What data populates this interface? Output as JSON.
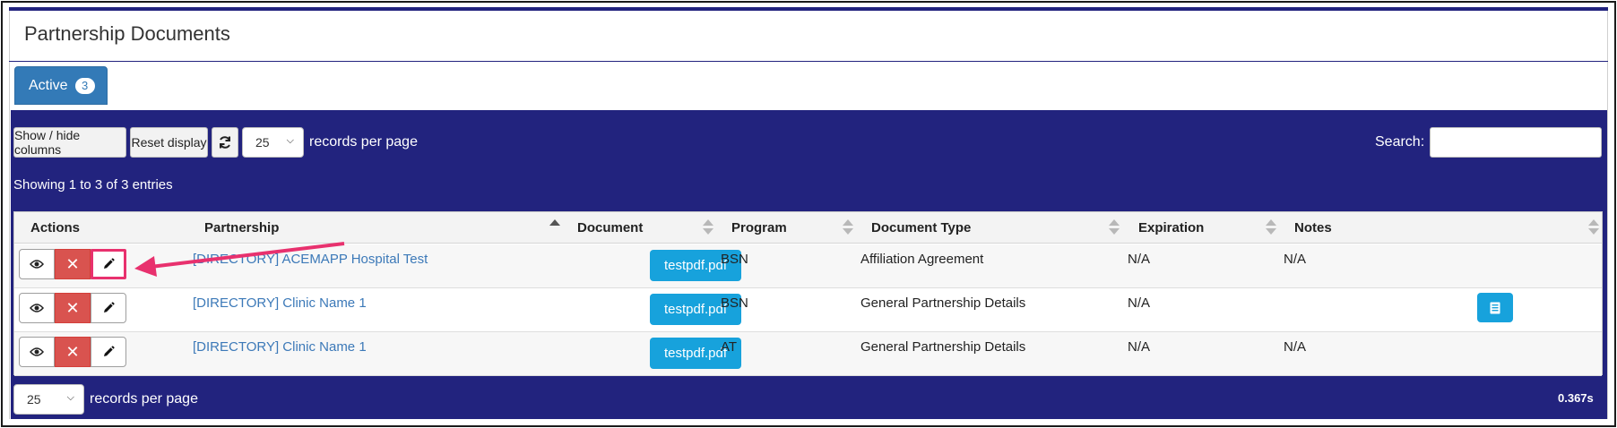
{
  "page": {
    "title": "Partnership Documents"
  },
  "tabs": [
    {
      "label": "Active",
      "count": "3"
    }
  ],
  "toolbar": {
    "show_hide_label": "Show / hide columns",
    "reset_label": "Reset display",
    "length_value": "25",
    "records_per_page": "records per page",
    "search_label": "Search:",
    "search_value": ""
  },
  "info": "Showing 1 to 3 of 3 entries",
  "table": {
    "headers": [
      "Actions",
      "Partnership",
      "Document",
      "Program",
      "Document Type",
      "Expiration",
      "Notes"
    ],
    "rows": [
      {
        "partnership": "[DIRECTORY] ACEMAPP Hospital Test",
        "document": "testpdf.pdf",
        "program": "BSN",
        "type": "Affiliation Agreement",
        "expiration": "N/A",
        "notes": "N/A"
      },
      {
        "partnership": "[DIRECTORY] Clinic Name 1",
        "document": "testpdf.pdf",
        "program": "BSN",
        "type": "General Partnership Details",
        "expiration": "N/A",
        "notes": ""
      },
      {
        "partnership": "[DIRECTORY] Clinic Name 1",
        "document": "testpdf.pdf",
        "program": "AT",
        "type": "General Partnership Details",
        "expiration": "N/A",
        "notes": "N/A"
      }
    ]
  },
  "footer": {
    "length_value": "25",
    "records_per_page": "records per page",
    "timer": "0.367s"
  },
  "icons": {
    "view": "eye-icon",
    "delete": "close-icon",
    "edit": "pencil-icon",
    "refresh": "refresh-icon",
    "notes": "notes-icon"
  },
  "colors": {
    "primary": "#22237e",
    "tab": "#337ab7",
    "info_button": "#17a2dc",
    "danger": "#d9534f",
    "annotation": "#e8316e"
  }
}
